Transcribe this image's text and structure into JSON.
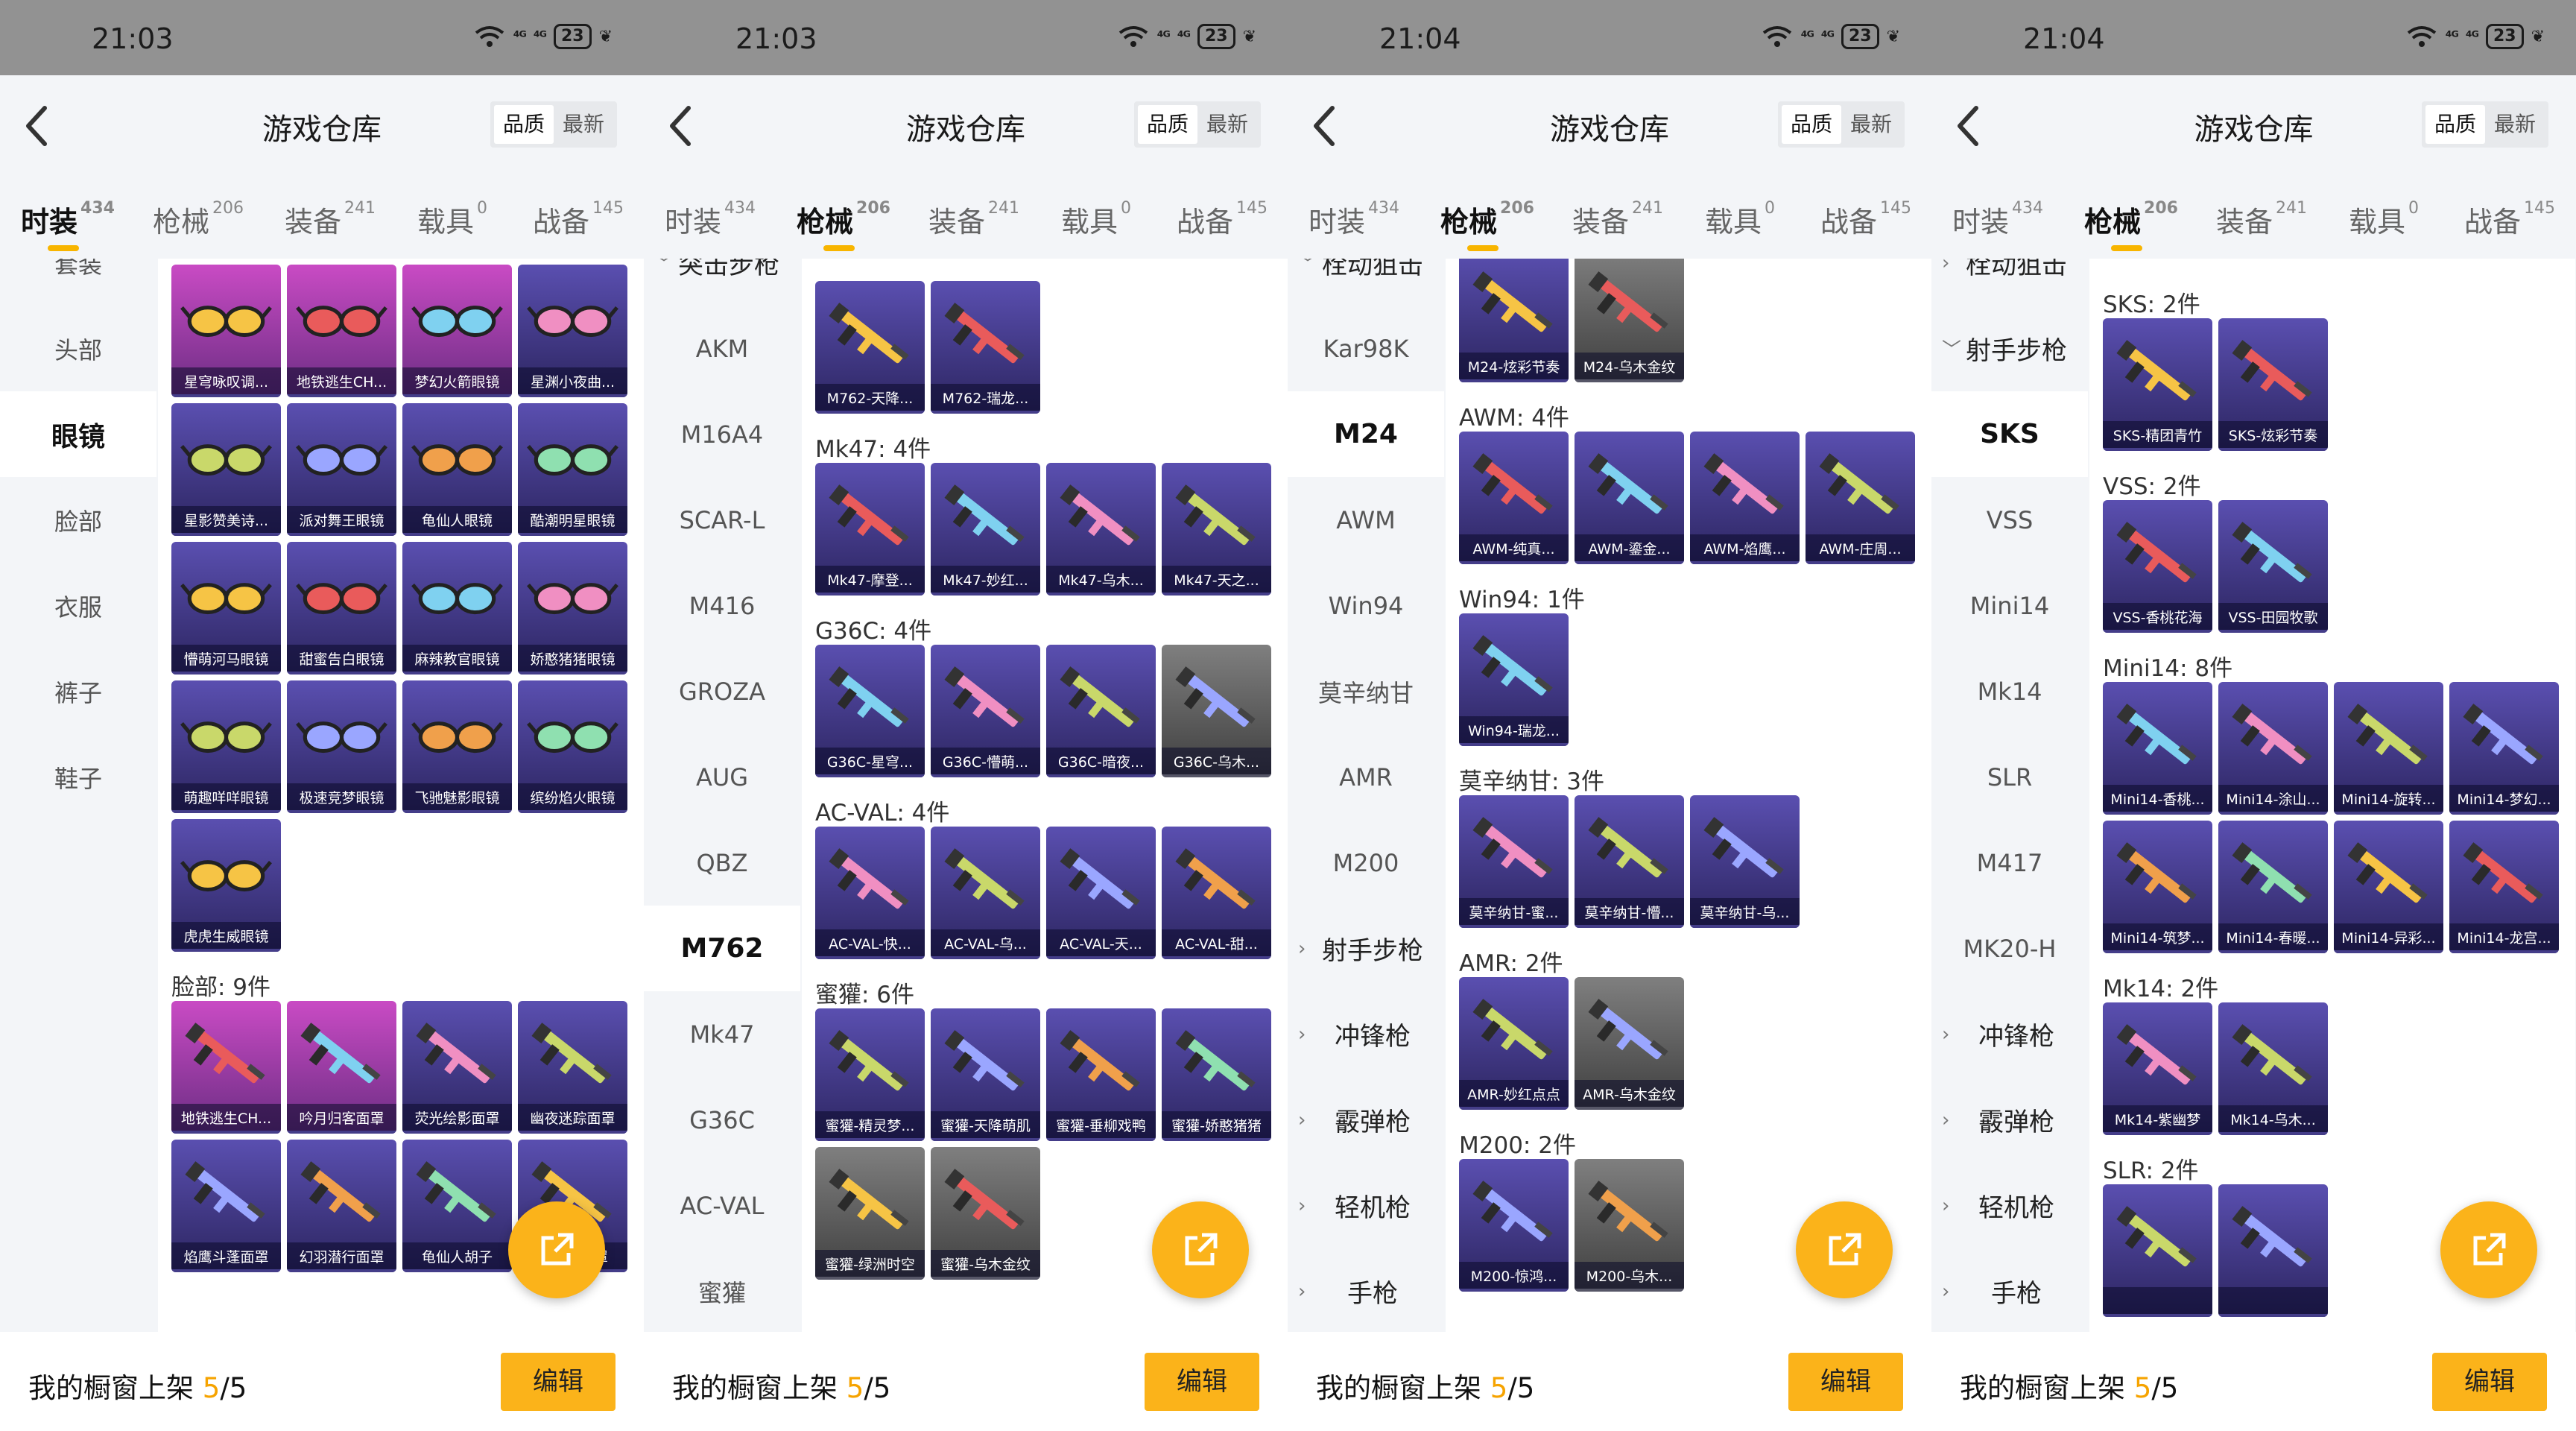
{
  "header": {
    "title": "游戏仓库",
    "sort_quality": "品质",
    "sort_latest": "最新"
  },
  "tabs": [
    {
      "label": "时装",
      "count": "434"
    },
    {
      "label": "枪械",
      "count": "206"
    },
    {
      "label": "装备",
      "count": "241"
    },
    {
      "label": "载具",
      "count": "0"
    },
    {
      "label": "战备",
      "count": "145"
    }
  ],
  "bottom": {
    "label": "我的橱窗上架 ",
    "count": "5",
    "total": "/5",
    "edit": "编辑"
  },
  "icons": {
    "back": "back-arrow-icon",
    "share": "share-icon",
    "wifi": "wifi-icon",
    "battery": "battery-icon",
    "chevron": "chevron-icon"
  },
  "colors": {
    "accent": "#fbb31a",
    "count_highlight": "#f6a300",
    "card_purple": "#3b3280",
    "card_pink": "#b341b0",
    "card_gray": "#5a5a5a"
  },
  "screens": [
    {
      "time": "21:03",
      "status": {
        "sig1": "⁴ᴳ",
        "sig2": "⁴ᴳ",
        "battery": "23"
      },
      "active_tab": 0,
      "sidebar": [
        {
          "label": "套装"
        },
        {
          "label": "头部"
        },
        {
          "label": "眼镜",
          "selected": true
        },
        {
          "label": "脸部"
        },
        {
          "label": "衣服"
        },
        {
          "label": "裤子"
        },
        {
          "label": "鞋子"
        }
      ],
      "sections": [
        {
          "title": "",
          "items": [
            {
              "label": "星穹咏叹调...",
              "style": "pink"
            },
            {
              "label": "地铁逃生CH...",
              "style": "pink"
            },
            {
              "label": "梦幻火箭眼镜",
              "style": "pink"
            },
            {
              "label": "星渊小夜曲...",
              "style": "purple"
            },
            {
              "label": "星影赞美诗...",
              "style": "purple"
            },
            {
              "label": "派对舞王眼镜",
              "style": "purple"
            },
            {
              "label": "龟仙人眼镜",
              "style": "purple"
            },
            {
              "label": "酷潮明星眼镜",
              "style": "purple"
            },
            {
              "label": "懵萌河马眼镜",
              "style": "purple"
            },
            {
              "label": "甜蜜告白眼镜",
              "style": "purple"
            },
            {
              "label": "麻辣教官眼镜",
              "style": "purple"
            },
            {
              "label": "娇憨猪猪眼镜",
              "style": "purple"
            },
            {
              "label": "萌趣咩咩眼镜",
              "style": "purple"
            },
            {
              "label": "极速竞梦眼镜",
              "style": "purple"
            },
            {
              "label": "飞驰魅影眼镜",
              "style": "purple"
            },
            {
              "label": "缤纷焰火眼镜",
              "style": "purple"
            },
            {
              "label": "虎虎生威眼镜",
              "style": "purple"
            }
          ]
        },
        {
          "title": "脸部: 9件",
          "items": [
            {
              "label": "地铁逃生CH...",
              "style": "pink"
            },
            {
              "label": "吟月归客面罩",
              "style": "pink"
            },
            {
              "label": "荧光绘影面罩",
              "style": "purple"
            },
            {
              "label": "幽夜迷踪面罩",
              "style": "purple"
            },
            {
              "label": "焰鹰斗蓬面罩",
              "style": "purple"
            },
            {
              "label": "幻羽潜行面罩",
              "style": "purple"
            },
            {
              "label": "龟仙人胡子",
              "style": "purple"
            },
            {
              "label": "沙漠风面罩",
              "style": "purple"
            }
          ]
        }
      ]
    },
    {
      "time": "21:03",
      "status": {
        "sig1": "⁴ᴳ",
        "sig2": "⁴ᴳ",
        "battery": "23"
      },
      "active_tab": 1,
      "sidebar": [
        {
          "label": "突击步枪",
          "category": true,
          "chevron": "﹀"
        },
        {
          "label": "AKM"
        },
        {
          "label": "M16A4"
        },
        {
          "label": "SCAR-L"
        },
        {
          "label": "M416"
        },
        {
          "label": "GROZA"
        },
        {
          "label": "AUG"
        },
        {
          "label": "QBZ"
        },
        {
          "label": "M762",
          "selected": true
        },
        {
          "label": "Mk47"
        },
        {
          "label": "G36C"
        },
        {
          "label": "AC-VAL"
        },
        {
          "label": "蜜獾"
        }
      ],
      "sections": [
        {
          "title": "",
          "items": [
            {
              "label": "M762-天降...",
              "style": "purple"
            },
            {
              "label": "M762-瑞龙...",
              "style": "purple"
            }
          ]
        },
        {
          "title": "Mk47: 4件",
          "items": [
            {
              "label": "Mk47-摩登...",
              "style": "purple"
            },
            {
              "label": "Mk47-妙红...",
              "style": "purple"
            },
            {
              "label": "Mk47-乌木...",
              "style": "purple"
            },
            {
              "label": "Mk47-天之...",
              "style": "purple"
            }
          ]
        },
        {
          "title": "G36C: 4件",
          "items": [
            {
              "label": "G36C-星穹...",
              "style": "purple"
            },
            {
              "label": "G36C-懵萌...",
              "style": "purple"
            },
            {
              "label": "G36C-暗夜...",
              "style": "purple"
            },
            {
              "label": "G36C-乌木...",
              "style": "gray"
            }
          ]
        },
        {
          "title": "AC-VAL: 4件",
          "items": [
            {
              "label": "AC-VAL-快...",
              "style": "purple"
            },
            {
              "label": "AC-VAL-乌...",
              "style": "purple"
            },
            {
              "label": "AC-VAL-天...",
              "style": "purple"
            },
            {
              "label": "AC-VAL-甜...",
              "style": "purple"
            }
          ]
        },
        {
          "title": "蜜獾: 6件",
          "items": [
            {
              "label": "蜜獾-精灵梦...",
              "style": "purple"
            },
            {
              "label": "蜜獾-天降萌肌",
              "style": "purple"
            },
            {
              "label": "蜜獾-垂柳戏鸭",
              "style": "purple"
            },
            {
              "label": "蜜獾-娇憨猪猪",
              "style": "purple"
            },
            {
              "label": "蜜獾-绿洲时空",
              "style": "gray"
            },
            {
              "label": "蜜獾-乌木金纹",
              "style": "gray"
            }
          ]
        }
      ]
    },
    {
      "time": "21:04",
      "status": {
        "sig1": "⁴ᴳ",
        "sig2": "⁴ᴳ",
        "battery": "23"
      },
      "active_tab": 1,
      "sidebar": [
        {
          "label": "栓动狙击",
          "category": true,
          "chevron": "﹀"
        },
        {
          "label": "Kar98K"
        },
        {
          "label": "M24",
          "selected": true
        },
        {
          "label": "AWM"
        },
        {
          "label": "Win94"
        },
        {
          "label": "莫辛纳甘"
        },
        {
          "label": "AMR"
        },
        {
          "label": "M200"
        },
        {
          "label": "射手步枪",
          "category": true,
          "chevron": "›"
        },
        {
          "label": "冲锋枪",
          "category": true,
          "chevron": "›"
        },
        {
          "label": "霰弹枪",
          "category": true,
          "chevron": "›"
        },
        {
          "label": "轻机枪",
          "category": true,
          "chevron": "›"
        },
        {
          "label": "手枪",
          "category": true,
          "chevron": "›"
        }
      ],
      "sections": [
        {
          "title": "",
          "items": [
            {
              "label": "M24-炫彩节奏",
              "style": "purple"
            },
            {
              "label": "M24-乌木金纹",
              "style": "gray"
            }
          ]
        },
        {
          "title": "AWM: 4件",
          "items": [
            {
              "label": "AWM-纯真...",
              "style": "purple"
            },
            {
              "label": "AWM-鎏金...",
              "style": "purple"
            },
            {
              "label": "AWM-焰鹰...",
              "style": "purple"
            },
            {
              "label": "AWM-庄周...",
              "style": "purple"
            }
          ]
        },
        {
          "title": "Win94: 1件",
          "items": [
            {
              "label": "Win94-瑞龙...",
              "style": "purple"
            }
          ]
        },
        {
          "title": "莫辛纳甘: 3件",
          "items": [
            {
              "label": "莫辛纳甘-蜜...",
              "style": "purple"
            },
            {
              "label": "莫辛纳甘-懵...",
              "style": "purple"
            },
            {
              "label": "莫辛纳甘-乌...",
              "style": "purple"
            }
          ]
        },
        {
          "title": "AMR: 2件",
          "items": [
            {
              "label": "AMR-妙红点点",
              "style": "purple"
            },
            {
              "label": "AMR-乌木金纹",
              "style": "gray"
            }
          ]
        },
        {
          "title": "M200: 2件",
          "items": [
            {
              "label": "M200-惊鸿...",
              "style": "purple"
            },
            {
              "label": "M200-乌木...",
              "style": "gray"
            }
          ]
        }
      ]
    },
    {
      "time": "21:04",
      "status": {
        "sig1": "⁴ᴳ",
        "sig2": "⁴ᴳ",
        "battery": "23"
      },
      "active_tab": 1,
      "sidebar": [
        {
          "label": "栓动狙击",
          "category": true,
          "chevron": "›"
        },
        {
          "label": "射手步枪",
          "category": true,
          "chevron": "﹀"
        },
        {
          "label": "SKS",
          "selected": true
        },
        {
          "label": "VSS"
        },
        {
          "label": "Mini14"
        },
        {
          "label": "Mk14"
        },
        {
          "label": "SLR"
        },
        {
          "label": "M417"
        },
        {
          "label": "MK20-H"
        },
        {
          "label": "冲锋枪",
          "category": true,
          "chevron": "›"
        },
        {
          "label": "霰弹枪",
          "category": true,
          "chevron": "›"
        },
        {
          "label": "轻机枪",
          "category": true,
          "chevron": "›"
        },
        {
          "label": "手枪",
          "category": true,
          "chevron": "›"
        }
      ],
      "sections": [
        {
          "title": "SKS: 2件",
          "items": [
            {
              "label": "SKS-精团青竹",
              "style": "purple"
            },
            {
              "label": "SKS-炫彩节奏",
              "style": "purple"
            }
          ]
        },
        {
          "title": "VSS: 2件",
          "items": [
            {
              "label": "VSS-香桃花海",
              "style": "purple"
            },
            {
              "label": "VSS-田园牧歌",
              "style": "purple"
            }
          ]
        },
        {
          "title": "Mini14: 8件",
          "items": [
            {
              "label": "Mini14-香桃...",
              "style": "purple"
            },
            {
              "label": "Mini14-涂山...",
              "style": "purple"
            },
            {
              "label": "Mini14-旋转...",
              "style": "purple"
            },
            {
              "label": "Mini14-梦幻...",
              "style": "purple"
            },
            {
              "label": "Mini14-筑梦...",
              "style": "purple"
            },
            {
              "label": "Mini14-春暖...",
              "style": "purple"
            },
            {
              "label": "Mini14-异彩...",
              "style": "purple"
            },
            {
              "label": "Mini14-龙宫...",
              "style": "purple"
            }
          ]
        },
        {
          "title": "Mk14: 2件",
          "items": [
            {
              "label": "Mk14-紫幽梦",
              "style": "purple"
            },
            {
              "label": "Mk14-乌木...",
              "style": "purple"
            }
          ]
        },
        {
          "title": "SLR: 2件",
          "items": [
            {
              "label": "",
              "style": "purple"
            },
            {
              "label": "",
              "style": "purple"
            }
          ]
        }
      ]
    }
  ]
}
